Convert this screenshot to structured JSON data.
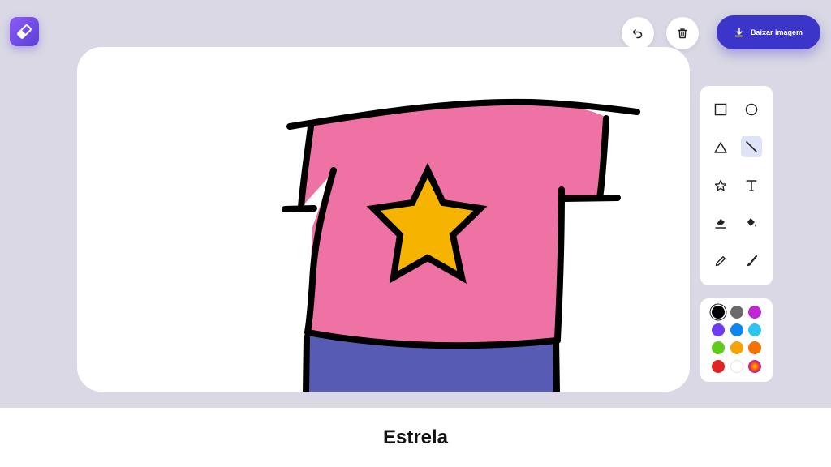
{
  "toolbar": {
    "download_label": "Baixar imagem",
    "download_icon": "download-icon",
    "undo_icon": "undo-icon",
    "delete_icon": "trash-icon",
    "logo_icon": "eraser-logo-icon"
  },
  "tools": {
    "items": [
      {
        "name": "rectangle",
        "icon": "square-icon"
      },
      {
        "name": "circle",
        "icon": "circle-icon"
      },
      {
        "name": "triangle",
        "icon": "triangle-icon"
      },
      {
        "name": "line",
        "icon": "line-icon",
        "active": true
      },
      {
        "name": "star",
        "icon": "star-icon"
      },
      {
        "name": "text",
        "icon": "text-icon"
      },
      {
        "name": "eraser",
        "icon": "eraser-icon"
      },
      {
        "name": "fill",
        "icon": "paint-bucket-icon"
      },
      {
        "name": "pencil",
        "icon": "pencil-icon"
      },
      {
        "name": "brush",
        "icon": "brush-icon"
      }
    ]
  },
  "palette": {
    "selected": "#000000",
    "colors": [
      "#000000",
      "#6b6b6b",
      "#c026d3",
      "#6d3cf2",
      "#0d87f0",
      "#2ec4f0",
      "#5fcb1a",
      "#f5a300",
      "#f57200",
      "#e02424",
      "#ffffff",
      "rainbow"
    ]
  },
  "drawing": {
    "colors": {
      "shirt": "#ef72a5",
      "star": "#f6b400",
      "pants": "#575bb3",
      "outline": "#000000"
    }
  },
  "caption": {
    "text": "Estrela"
  }
}
